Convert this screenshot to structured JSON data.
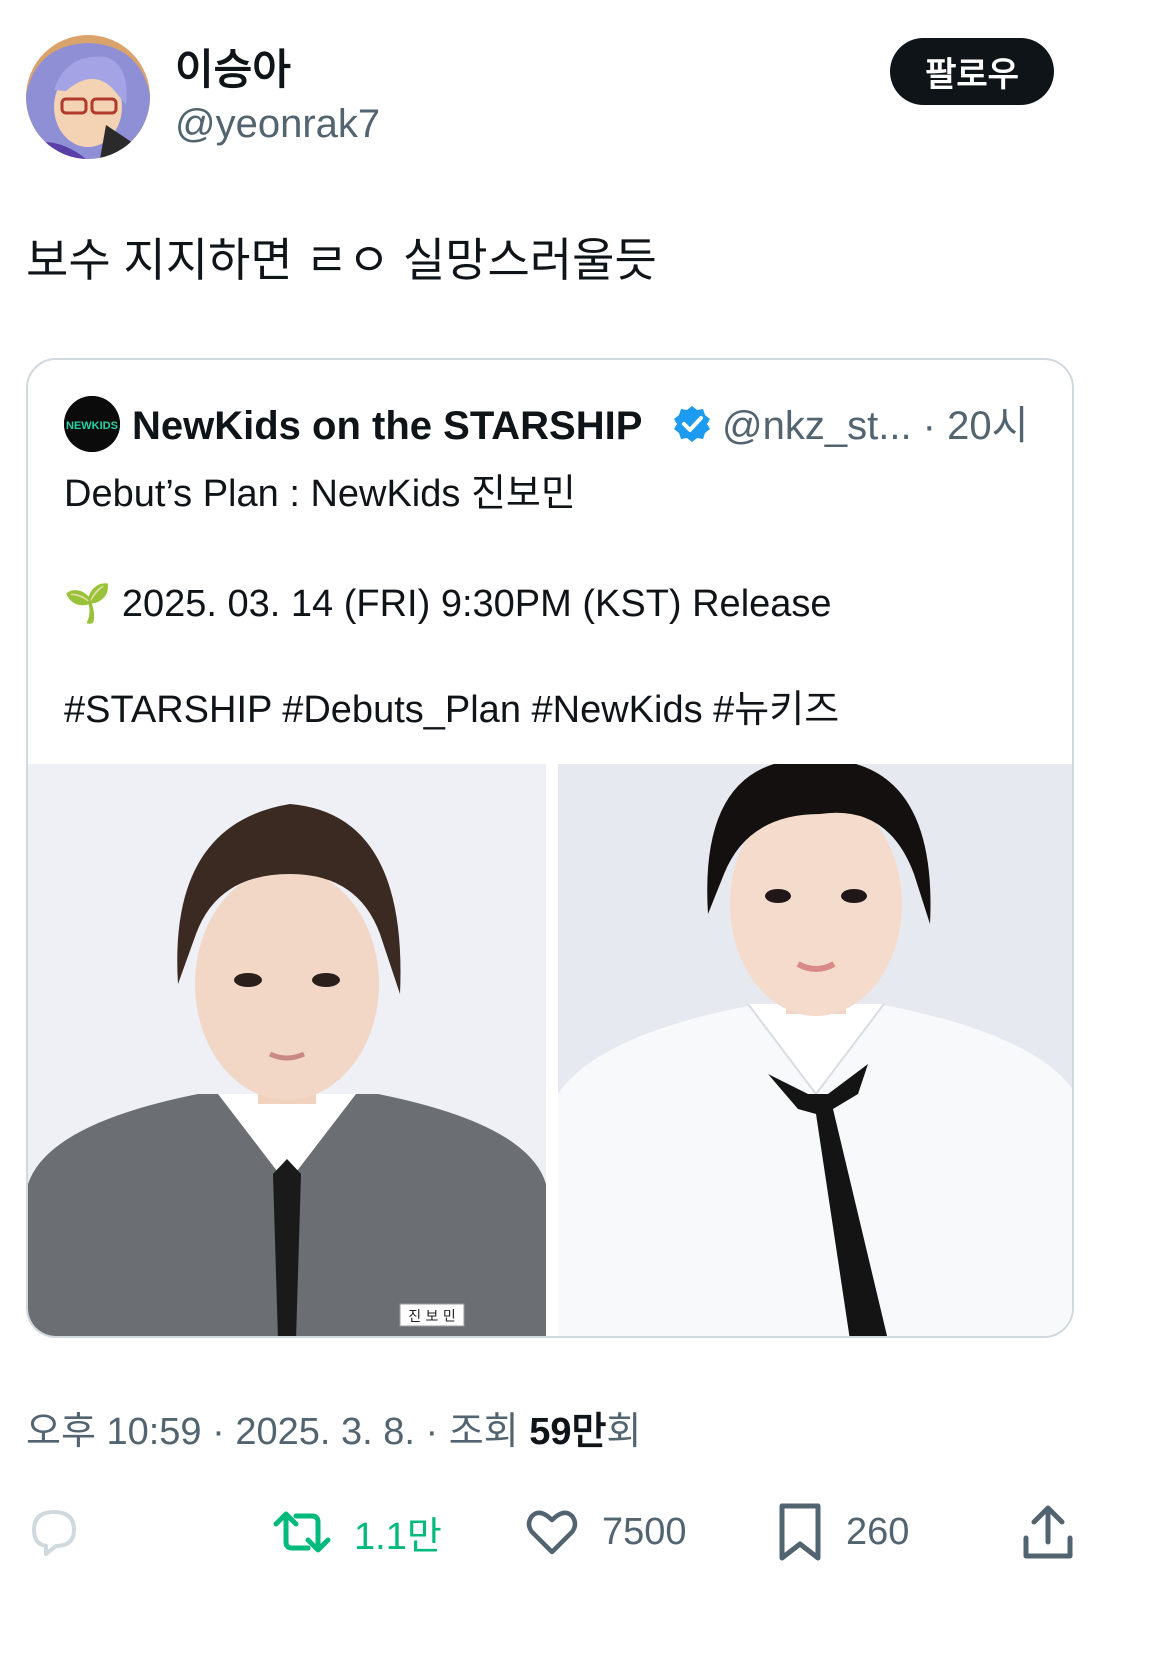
{
  "author": {
    "display_name": "이승아",
    "handle": "@yeonrak7",
    "follow_label": "팔로우"
  },
  "tweet_text": "보수 지지하면 ㄹㅇ 실망스러울듯",
  "quote": {
    "name": "NewKids on the STARSHIP",
    "handle_time": "@nkz_st... · 20시",
    "avatar_text": "NEWKIDS",
    "line1": "Debut’s Plan : NewKids 진보민",
    "line2_emoji": "🌱",
    "line2": "2025. 03. 14 (FRI) 9:30PM (KST) Release",
    "hashtags": "#STARSHIP #Debuts_Plan #NewKids #뉴키즈",
    "photo_label": "진 보 민"
  },
  "meta": {
    "prefix": "오후 10:59 · 2025. 3. 8. · 조회 ",
    "views": "59만",
    "suffix": "회"
  },
  "actions": {
    "retweets": "1.1만",
    "likes": "7500",
    "bookmarks": "260"
  },
  "icons": [
    "reply-icon",
    "retweet-icon",
    "like-icon",
    "bookmark-icon",
    "share-icon",
    "verified-badge-icon"
  ],
  "colors": {
    "retweet_green": "#00ba7c",
    "verified_blue": "#1d9bf0",
    "follow_bg": "#0f1419"
  }
}
